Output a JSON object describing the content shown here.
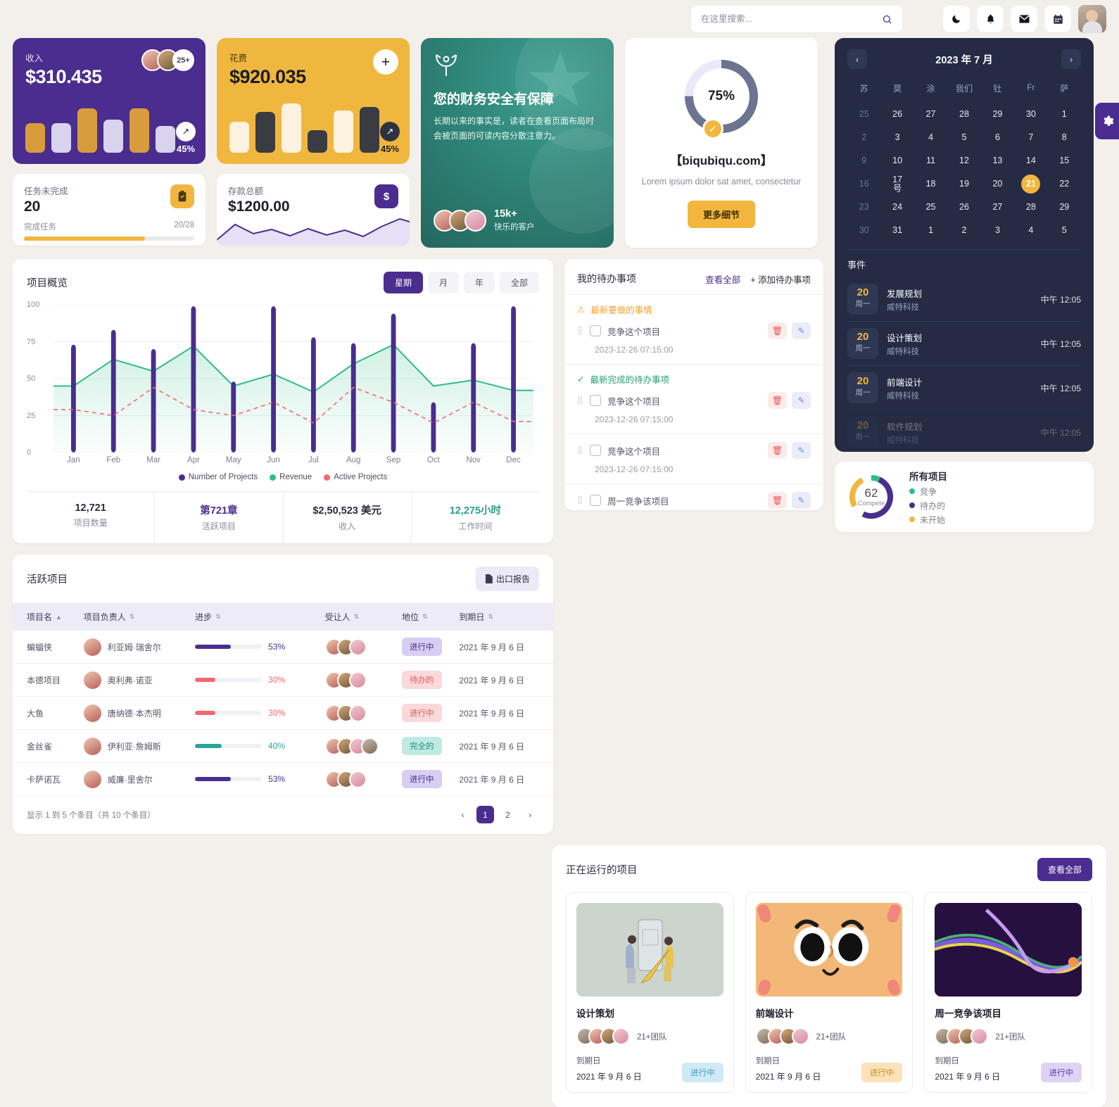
{
  "header": {
    "search_placeholder": "在这里搜索...",
    "search_value": "",
    "icons": [
      "moon-icon",
      "bell-icon",
      "mail-icon",
      "calendar-icon"
    ]
  },
  "revenue_card": {
    "label": "收入",
    "value": "$310.435",
    "more_avatars": "25+",
    "trend": "45%",
    "trend_arrow": "↗"
  },
  "expense_card": {
    "label": "花费",
    "value": "$920.035",
    "plus": "+",
    "trend": "45%",
    "trend_arrow": "↗"
  },
  "tasks_card": {
    "label": "任务未完成",
    "value": "20",
    "sub_label": "完成任务",
    "sub_value": "20/28",
    "progress": 71
  },
  "deposit_card": {
    "label": "存款总额",
    "value": "$1200.00",
    "icon": "dollar-icon"
  },
  "promo_card": {
    "title": "您的财务安全有保障",
    "desc": "长期以来的事实是，读者在查看页面布局时会被页面的可读内容分散注意力。",
    "count": "15k+",
    "count_label": "快乐的客户"
  },
  "ring_card": {
    "percent": "75%",
    "percent_value": 75,
    "title": "【biqubiqu.com】",
    "subtitle": "Lorem ipsum dolor sat amet, consectetur",
    "button": "更多细节"
  },
  "calendar": {
    "title": "2023 年 7 月",
    "prev": "‹",
    "next": "›",
    "dow": [
      "苏",
      "莫",
      "涂",
      "我们",
      "钍",
      "Fr",
      "萨"
    ],
    "weeks": [
      [
        {
          "d": "25",
          "m": true
        },
        {
          "d": "26"
        },
        {
          "d": "27"
        },
        {
          "d": "28"
        },
        {
          "d": "29"
        },
        {
          "d": "30"
        },
        {
          "d": "1"
        }
      ],
      [
        {
          "d": "2",
          "m": true
        },
        {
          "d": "3"
        },
        {
          "d": "4"
        },
        {
          "d": "5"
        },
        {
          "d": "6"
        },
        {
          "d": "7"
        },
        {
          "d": "8"
        }
      ],
      [
        {
          "d": "9",
          "m": true
        },
        {
          "d": "10"
        },
        {
          "d": "11"
        },
        {
          "d": "12"
        },
        {
          "d": "13"
        },
        {
          "d": "14"
        },
        {
          "d": "15"
        }
      ],
      [
        {
          "d": "16",
          "m": true
        },
        {
          "d": "17 号"
        },
        {
          "d": "18"
        },
        {
          "d": "19"
        },
        {
          "d": "20"
        },
        {
          "d": "21",
          "sel": true
        },
        {
          "d": "22"
        }
      ],
      [
        {
          "d": "23",
          "m": true
        },
        {
          "d": "24"
        },
        {
          "d": "25"
        },
        {
          "d": "26"
        },
        {
          "d": "27"
        },
        {
          "d": "28"
        },
        {
          "d": "29"
        }
      ],
      [
        {
          "d": "30",
          "m": true
        },
        {
          "d": "31"
        },
        {
          "d": "1"
        },
        {
          "d": "2"
        },
        {
          "d": "3"
        },
        {
          "d": "4"
        },
        {
          "d": "5"
        }
      ]
    ],
    "events_title": "事件",
    "events": [
      {
        "day": "20",
        "weekday": "周一",
        "name": "发展规划",
        "company": "威特科技",
        "time": "中午 12:05"
      },
      {
        "day": "20",
        "weekday": "周一",
        "name": "设计策划",
        "company": "威特科技",
        "time": "中午 12:05"
      },
      {
        "day": "20",
        "weekday": "周一",
        "name": "前端设计",
        "company": "威特科技",
        "time": "中午 12:05"
      },
      {
        "day": "20",
        "weekday": "周一",
        "name": "软件规划",
        "company": "威特科技",
        "time": "中午 12:05"
      }
    ]
  },
  "donut_card": {
    "center_value": "62",
    "center_label": "Compete",
    "title": "所有项目",
    "legend": [
      {
        "label": "竞争",
        "color": "#2fbd85"
      },
      {
        "label": "待办的",
        "color": "#4a2d8f"
      },
      {
        "label": "未开始",
        "color": "#f2b63f"
      }
    ]
  },
  "chart_card": {
    "title": "项目概览",
    "segments": [
      "星期",
      "月",
      "年",
      "全部"
    ],
    "active_segment": "星期",
    "stats": [
      {
        "value": "12,721",
        "label": "项目数量",
        "color": "#2b2b3c"
      },
      {
        "value": "第721章",
        "label": "活跃项目",
        "color": "#4a2d8f"
      },
      {
        "value": "$2,50,523 美元",
        "label": "收入",
        "color": "#2b2b3c"
      },
      {
        "value": "12,275小时",
        "label": "工作时间",
        "color": "#2b9e8c"
      }
    ]
  },
  "chart_data": {
    "type": "bar",
    "title": "项目概览",
    "xlabel": "",
    "ylabel": "",
    "ylim": [
      0,
      100
    ],
    "yticks": [
      0,
      25,
      50,
      75,
      100
    ],
    "grid": true,
    "legend_position": "bottom",
    "categories": [
      "Jan",
      "Feb",
      "Mar",
      "Apr",
      "May",
      "Jun",
      "Jul",
      "Aug",
      "Sep",
      "Oct",
      "Nov",
      "Dec"
    ],
    "series": [
      {
        "name": "Number of Projects",
        "type": "bar",
        "color": "#4a2d8f",
        "values": [
          73,
          83,
          70,
          99,
          48,
          99,
          78,
          74,
          94,
          34,
          74,
          99
        ]
      },
      {
        "name": "Revenue",
        "type": "area",
        "color": "#2fbd85",
        "values": [
          45,
          63,
          55,
          72,
          45,
          53,
          41,
          60,
          73,
          45,
          49,
          42
        ]
      },
      {
        "name": "Active Projects",
        "type": "line",
        "color": "#f4686d",
        "dashed": true,
        "values": [
          29,
          25,
          44,
          29,
          25,
          34,
          20,
          44,
          34,
          20,
          34,
          21
        ]
      }
    ]
  },
  "todo_card": {
    "title": "我的待办事项",
    "view_all": "查看全部",
    "add": "+ 添加待办事项",
    "groups": [
      {
        "icon": "warning-icon",
        "label": "最新要做的事情",
        "kind": "warn",
        "items": [
          {
            "name": "竞争这个项目",
            "time": "2023-12-26 07:15:00"
          }
        ]
      },
      {
        "icon": "check-icon",
        "label": "最新完成的待办事项",
        "kind": "done",
        "items": [
          {
            "name": "竞争这个项目",
            "time": "2023-12-26 07:15:00"
          }
        ]
      },
      {
        "icon": "",
        "label": "",
        "kind": "plain",
        "items": [
          {
            "name": "竞争这个项目",
            "time": "2023-12-26 07:15:00"
          }
        ]
      },
      {
        "icon": "",
        "label": "",
        "kind": "plain",
        "items": [
          {
            "name": "周一竞争该项目",
            "time": ""
          }
        ]
      }
    ]
  },
  "table_card": {
    "title": "活跃项目",
    "export": "出口报告",
    "columns": [
      "项目名",
      "项目负责人",
      "进步",
      "受让人",
      "地位",
      "到期日"
    ],
    "rows": [
      {
        "name": "蝙蝠侠",
        "manager": "利亚姆·瑞舍尔",
        "progress": 53,
        "progress_label": "53%",
        "progress_color": "#4a2d8f",
        "assignees": 3,
        "status": "进行中",
        "status_bg": "#d8cdf2",
        "status_fg": "#4a2d8f",
        "due": "2021 年 9 月 6 日"
      },
      {
        "name": "本德项目",
        "manager": "奥利弗·诺亚",
        "progress": 30,
        "progress_label": "30%",
        "progress_color": "#f4686d",
        "assignees": 3,
        "status": "待办的",
        "status_bg": "#fbd9d9",
        "status_fg": "#e8555a",
        "due": "2021 年 9 月 6 日"
      },
      {
        "name": "大鱼",
        "manager": "唐纳德·本杰明",
        "progress": 30,
        "progress_label": "30%",
        "progress_color": "#f4686d",
        "assignees": 3,
        "status": "进行中",
        "status_bg": "#fbd9d9",
        "status_fg": "#e8555a",
        "due": "2021 年 9 月 6 日"
      },
      {
        "name": "金丝雀",
        "manager": "伊利亚·詹姆斯",
        "progress": 40,
        "progress_label": "40%",
        "progress_color": "#2ba598",
        "assignees": 4,
        "status": "完全的",
        "status_bg": "#bfeae2",
        "status_fg": "#20907f",
        "due": "2021 年 9 月 6 日"
      },
      {
        "name": "卡萨诺瓦",
        "manager": "威廉·里舍尔",
        "progress": 53,
        "progress_label": "53%",
        "progress_color": "#4a2d8f",
        "assignees": 3,
        "status": "进行中",
        "status_bg": "#d8cdf2",
        "status_fg": "#4a2d8f",
        "due": "2021 年 9 月 6 日"
      }
    ],
    "footer_info": "显示 1 到 5 个条目（共 10 个条目）",
    "pages": [
      "1",
      "2"
    ],
    "active_page": "1"
  },
  "running_card": {
    "title": "正在运行的项目",
    "view_all": "查看全部",
    "projects": [
      {
        "name": "设计策划",
        "team": "21+团队",
        "due_label": "到期日",
        "due": "2021 年 9 月 6 日",
        "status": "进行中",
        "status_bg": "#cfeaf5",
        "status_fg": "#3f9fc0",
        "thumb": "illustration-mobile"
      },
      {
        "name": "前端设计",
        "team": "21+团队",
        "due_label": "到期日",
        "due": "2021 年 9 月 6 日",
        "status": "进行中",
        "status_bg": "#fbe2b9",
        "status_fg": "#d08a1c",
        "thumb": "illustration-face"
      },
      {
        "name": "周一竞争该项目",
        "team": "21+团队",
        "due_label": "到期日",
        "due": "2021 年 9 月 6 日",
        "status": "进行中",
        "status_bg": "#ded3f5",
        "status_fg": "#5b3bb0",
        "thumb": "illustration-waves"
      }
    ]
  },
  "settings_tab": {
    "icon": "gear-icon"
  }
}
